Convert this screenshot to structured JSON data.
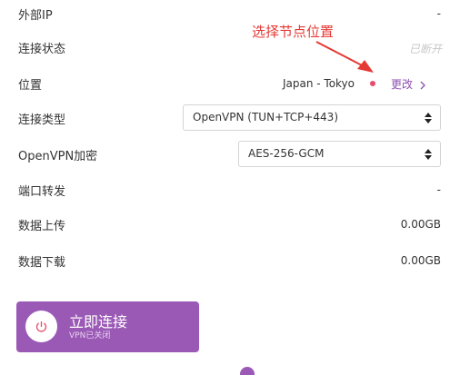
{
  "rows": {
    "external_ip": {
      "label": "外部IP",
      "value": "-"
    },
    "connection_status": {
      "label": "连接状态",
      "value": "已断开"
    },
    "location": {
      "label": "位置",
      "value": "Japan - Tokyo",
      "change_label": "更改",
      "change_icon": "chevron-right-icon"
    },
    "connection_type": {
      "label": "连接类型",
      "selected": "OpenVPN (TUN+TCP+443)"
    },
    "openvpn_encryption": {
      "label": "OpenVPN加密",
      "selected": "AES-256-GCM"
    },
    "port_forwarding": {
      "label": "端口转发",
      "value": "-"
    },
    "data_upload": {
      "label": "数据上传",
      "value": "0.00GB"
    },
    "data_download": {
      "label": "数据下载",
      "value": "0.00GB"
    }
  },
  "annotation": {
    "text": "选择节点位置",
    "color": "#e53935"
  },
  "connect_button": {
    "title": "立即连接",
    "subtitle": "VPN已关闭",
    "icon": "power-icon",
    "color": "#9b59b6"
  },
  "colors": {
    "status_dot": "#e84d6b",
    "link": "#8e4fb0",
    "muted": "#c8c8c8"
  }
}
